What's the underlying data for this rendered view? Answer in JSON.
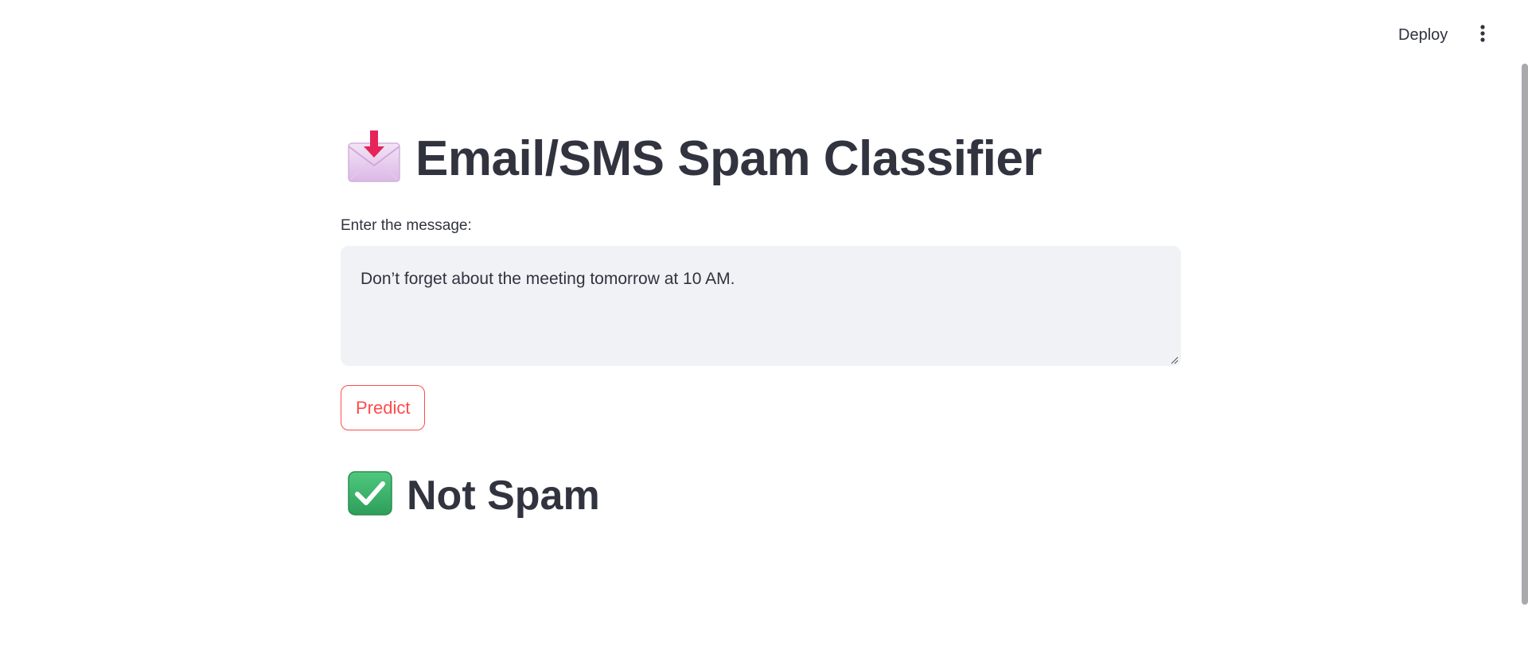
{
  "header": {
    "deploy_label": "Deploy",
    "menu_icon": "more-vertical-icon"
  },
  "main": {
    "title_icon": "incoming-envelope-icon",
    "title": "Email/SMS Spam Classifier",
    "input_label": "Enter the message:",
    "message_value": "Don’t forget about the meeting tomorrow at 10 AM.",
    "predict_label": "Predict",
    "result_icon": "check-mark-button-icon",
    "result_text": "Not Spam"
  },
  "colors": {
    "text": "#31333f",
    "accent": "#ff4b4b",
    "input_bg": "#f0f2f6",
    "success": "#3cb371"
  }
}
